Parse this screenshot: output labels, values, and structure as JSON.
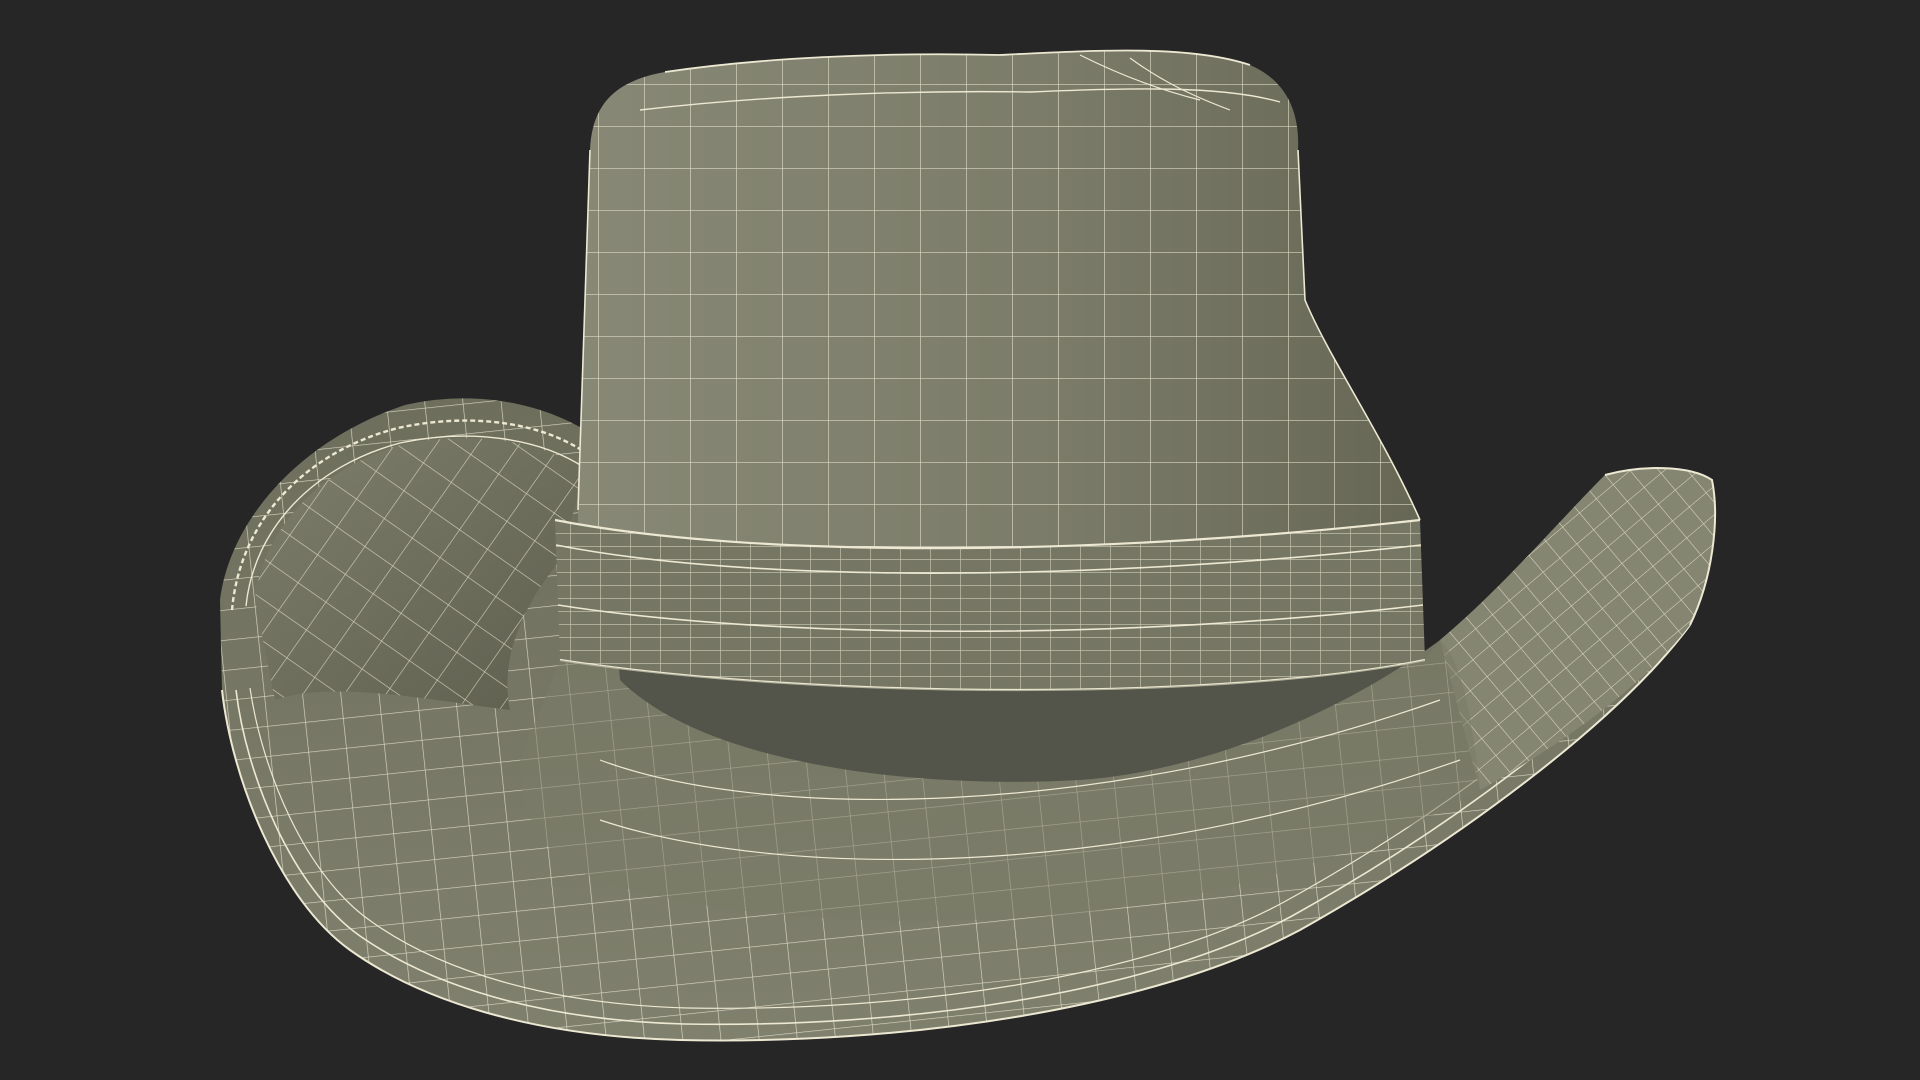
{
  "scene": {
    "subject": "hat-wireframe",
    "colors": {
      "background": "#262626",
      "surface": "#7b7c69",
      "surface_light": "#8a8b77",
      "surface_dark": "#5f604f",
      "wire": "#ece8d2"
    }
  }
}
